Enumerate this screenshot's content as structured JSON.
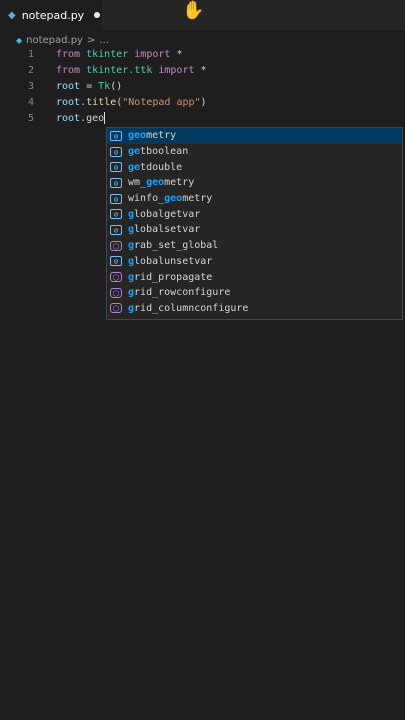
{
  "tab": {
    "filename": "notepad.py",
    "icon": "python-file-icon",
    "dirty": true
  },
  "breadcrumb": {
    "file": "notepad.py",
    "separator": ">",
    "more": "..."
  },
  "lines": [
    {
      "n": "1",
      "tokens": [
        [
          "kw",
          "from "
        ],
        [
          "mod",
          "tkinter "
        ],
        [
          "kw",
          "import "
        ],
        [
          "op",
          "*"
        ]
      ]
    },
    {
      "n": "2",
      "tokens": [
        [
          "kw",
          "from "
        ],
        [
          "mod",
          "tkinter.ttk "
        ],
        [
          "kw",
          "import "
        ],
        [
          "op",
          "*"
        ]
      ]
    },
    {
      "n": "3",
      "tokens": [
        [
          "var",
          "root "
        ],
        [
          "op",
          "= "
        ],
        [
          "mod",
          "Tk"
        ],
        [
          "op",
          "()"
        ]
      ]
    },
    {
      "n": "4",
      "tokens": [
        [
          "var",
          "root"
        ],
        [
          "op",
          "."
        ],
        [
          "fn",
          "title"
        ],
        [
          "op",
          "("
        ],
        [
          "str",
          "\"Notepad app\""
        ],
        [
          "op",
          ")"
        ]
      ]
    },
    {
      "n": "5",
      "tokens": [
        [
          "var",
          "root"
        ],
        [
          "op",
          "."
        ],
        [
          "op",
          "geo"
        ]
      ]
    }
  ],
  "suggestions": [
    {
      "kind": "variable",
      "pre": "",
      "match": "geo",
      "post": "metry",
      "selected": true
    },
    {
      "kind": "variable",
      "pre": "",
      "match": "ge",
      "post": "tboolean",
      "selected": false
    },
    {
      "kind": "variable",
      "pre": "",
      "match": "ge",
      "post": "tdouble",
      "selected": false
    },
    {
      "kind": "variable",
      "pre": "wm_",
      "match": "geo",
      "post": "metry",
      "selected": false
    },
    {
      "kind": "variable",
      "pre": "winfo_",
      "match": "geo",
      "post": "metry",
      "selected": false
    },
    {
      "kind": "variable",
      "pre": "",
      "match": "g",
      "post": "lobalgetvar",
      "selected": false
    },
    {
      "kind": "variable",
      "pre": "",
      "match": "g",
      "post": "lobalsetvar",
      "selected": false
    },
    {
      "kind": "method",
      "pre": "",
      "match": "g",
      "post": "rab_set_global",
      "selected": false
    },
    {
      "kind": "variable",
      "pre": "",
      "match": "g",
      "post": "lobalunsetvar",
      "selected": false
    },
    {
      "kind": "method",
      "pre": "",
      "match": "g",
      "post": "rid_propagate",
      "selected": false
    },
    {
      "kind": "method",
      "pre": "",
      "match": "g",
      "post": "rid_rowconfigure",
      "selected": false
    },
    {
      "kind": "method",
      "pre": "",
      "match": "g",
      "post": "rid_columnconfigure",
      "selected": false
    }
  ],
  "colors": {
    "accent": "#18a3ff",
    "selection": "#04395e",
    "background": "#1e1e1e"
  }
}
